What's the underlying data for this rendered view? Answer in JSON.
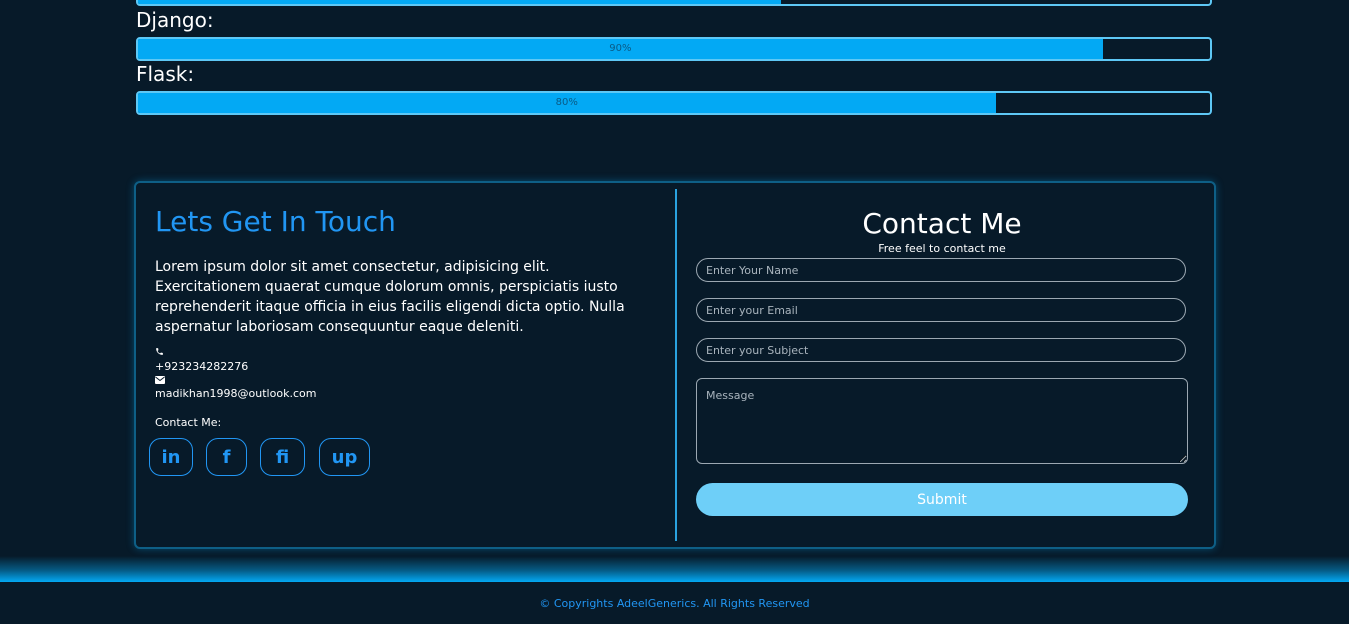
{
  "skills": [
    {
      "label": "",
      "percent": 60,
      "pct_text": ""
    },
    {
      "label": "Django:",
      "percent": 90,
      "pct_text": "90%"
    },
    {
      "label": "Flask:",
      "percent": 80,
      "pct_text": "80%"
    }
  ],
  "touch": {
    "title": "Lets Get In Touch",
    "description": "Lorem ipsum dolor sit amet consectetur, adipisicing elit. Exercitationem quaerat cumque dolorum omnis, perspiciatis iusto reprehenderit itaque officia in eius facilis eligendi dicta optio. Nulla aspernatur laboriosam consequuntur eaque deleniti.",
    "phone": "+923234282276",
    "email": "madikhan1998@outlook.com",
    "social_label": "Contact Me:",
    "social": [
      "in",
      "f",
      "fi",
      "up"
    ]
  },
  "contact": {
    "title": "Contact Me",
    "subtitle": "Free feel to contact me",
    "name_placeholder": "Enter Your Name",
    "email_placeholder": "Enter your Email",
    "subject_placeholder": "Enter your Subject",
    "message_placeholder": "Message",
    "submit_label": "Submit"
  },
  "footer": {
    "text": "© Copyrights AdeelGenerics. All Rights Reserved"
  },
  "colors": {
    "accent": "#03a9f4",
    "title_blue": "#2196f3",
    "background": "#071a29",
    "submit": "#6ecff8"
  }
}
